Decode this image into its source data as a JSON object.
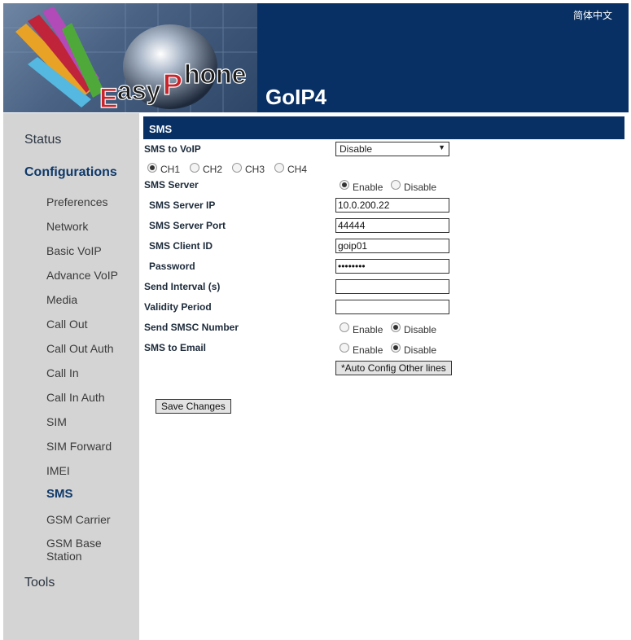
{
  "header": {
    "language_link": "简体中文",
    "device_title": "GoIP4",
    "logo_text": "EasyPhone"
  },
  "sidebar": {
    "status": "Status",
    "configurations": "Configurations",
    "items": [
      "Preferences",
      "Network",
      "Basic VoIP",
      "Advance VoIP",
      "Media",
      "Call Out",
      "Call Out Auth",
      "Call In",
      "Call In Auth",
      "SIM",
      "SIM Forward",
      "IMEI",
      "SMS",
      "GSM Carrier",
      "GSM Base Station"
    ],
    "active_item": "SMS",
    "tools": "Tools"
  },
  "main": {
    "section_title": "SMS",
    "sms_to_voip": {
      "label": "SMS to VoIP",
      "value": "Disable"
    },
    "channels": [
      {
        "label": "CH1",
        "checked": true
      },
      {
        "label": "CH2",
        "checked": false
      },
      {
        "label": "CH3",
        "checked": false
      },
      {
        "label": "CH4",
        "checked": false
      }
    ],
    "sms_server": {
      "label": "SMS Server",
      "enable": "Enable",
      "disable": "Disable",
      "selected": "Enable"
    },
    "server_ip": {
      "label": "SMS Server IP",
      "value": "10.0.200.22"
    },
    "server_port": {
      "label": "SMS Server Port",
      "value": "44444"
    },
    "client_id": {
      "label": "SMS Client ID",
      "value": "goip01"
    },
    "password": {
      "label": "Password",
      "value": "••••••••"
    },
    "send_interval": {
      "label": "Send Interval (s)",
      "value": ""
    },
    "validity_period": {
      "label": "Validity Period",
      "value": ""
    },
    "send_smsc": {
      "label": "Send SMSC Number",
      "enable": "Enable",
      "disable": "Disable",
      "selected": "Disable"
    },
    "sms_to_email": {
      "label": "SMS to Email",
      "enable": "Enable",
      "disable": "Disable",
      "selected": "Disable"
    },
    "auto_config_button": "*Auto Config Other lines",
    "save_button": "Save Changes"
  },
  "colors": {
    "header_bg": "#083064",
    "sidebar_bg": "#d4d4d4",
    "active_nav": "#0e3868"
  }
}
